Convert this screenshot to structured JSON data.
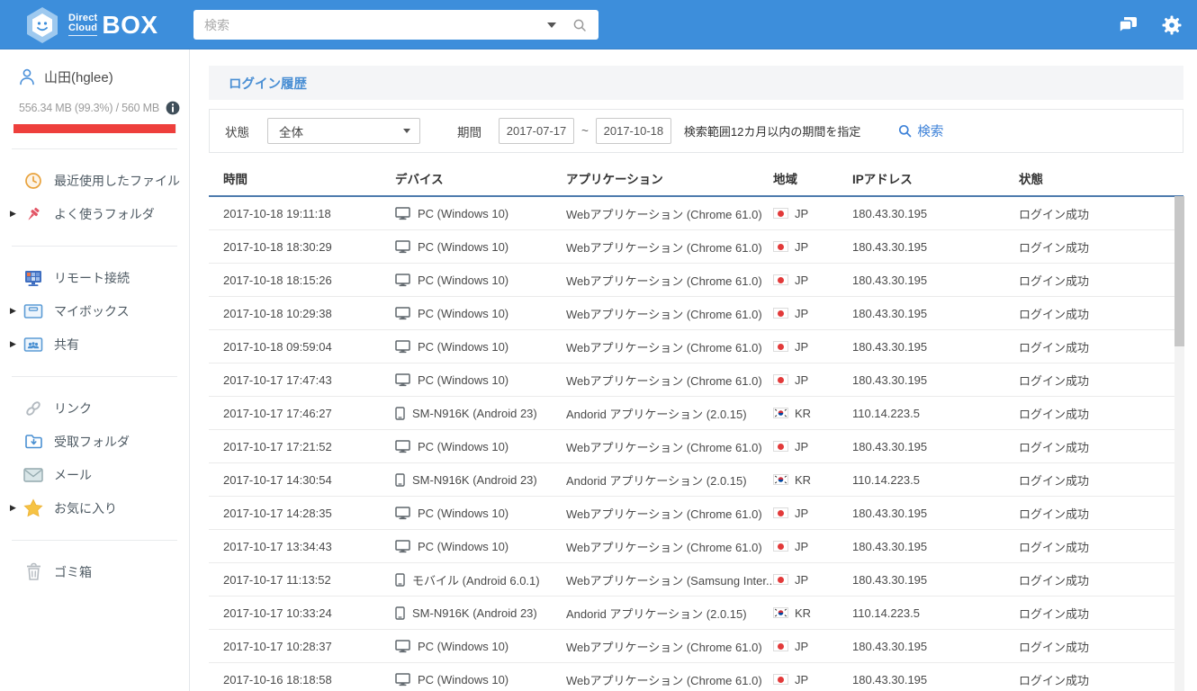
{
  "colors": {
    "header_bg": "#3d8edb",
    "title_text": "#4a8fd4",
    "storage_bar": "#ee3f3c",
    "link_blue": "#3e82d8",
    "table_header_border": "#4e7bad"
  },
  "header": {
    "logo": {
      "line1": "Direct",
      "line2": "Cloud",
      "box": "BOX"
    },
    "search": {
      "placeholder": "検索"
    }
  },
  "sidebar": {
    "user": {
      "name": "山田(hglee)"
    },
    "storage": {
      "usage_text": "556.34 MB (99.3%) / 560 MB",
      "percent": 99.3
    },
    "items": [
      {
        "label": "最近使用したファイル",
        "icon": "clock"
      },
      {
        "label": "よく使うフォルダ",
        "icon": "pin",
        "expandable": true
      },
      {
        "label": "リモート接続",
        "icon": "remote-desktop"
      },
      {
        "label": "マイボックス",
        "icon": "box",
        "expandable": true
      },
      {
        "label": "共有",
        "icon": "shared-box",
        "expandable": true
      },
      {
        "label": "リンク",
        "icon": "link"
      },
      {
        "label": "受取フォルダ",
        "icon": "receive-folder"
      },
      {
        "label": "メール",
        "icon": "mail"
      },
      {
        "label": "お気に入り",
        "icon": "star",
        "expandable": true
      },
      {
        "label": "ゴミ箱",
        "icon": "trash"
      }
    ]
  },
  "main": {
    "page_title": "ログイン履歴",
    "filters": {
      "status_label": "状態",
      "status_value": "全体",
      "period_label": "期間",
      "date_from": "2017-07-17",
      "date_separator": "~",
      "date_to": "2017-10-18",
      "hint": "検索範囲12カ月以内の期間を指定",
      "search_label": "検索"
    },
    "table": {
      "columns": [
        "時間",
        "デバイス",
        "アプリケーション",
        "地域",
        "IPアドレス",
        "状態"
      ],
      "rows": [
        {
          "time": "2017-10-18 19:11:18",
          "device": "PC (Windows 10)",
          "device_type": "pc",
          "app": "Webアプリケーション (Chrome 61.0)",
          "region": "JP",
          "ip": "180.43.30.195",
          "status": "ログイン成功"
        },
        {
          "time": "2017-10-18 18:30:29",
          "device": "PC (Windows 10)",
          "device_type": "pc",
          "app": "Webアプリケーション (Chrome 61.0)",
          "region": "JP",
          "ip": "180.43.30.195",
          "status": "ログイン成功"
        },
        {
          "time": "2017-10-18 18:15:26",
          "device": "PC (Windows 10)",
          "device_type": "pc",
          "app": "Webアプリケーション (Chrome 61.0)",
          "region": "JP",
          "ip": "180.43.30.195",
          "status": "ログイン成功"
        },
        {
          "time": "2017-10-18 10:29:38",
          "device": "PC (Windows 10)",
          "device_type": "pc",
          "app": "Webアプリケーション (Chrome 61.0)",
          "region": "JP",
          "ip": "180.43.30.195",
          "status": "ログイン成功"
        },
        {
          "time": "2017-10-18 09:59:04",
          "device": "PC (Windows 10)",
          "device_type": "pc",
          "app": "Webアプリケーション (Chrome 61.0)",
          "region": "JP",
          "ip": "180.43.30.195",
          "status": "ログイン成功"
        },
        {
          "time": "2017-10-17 17:47:43",
          "device": "PC (Windows 10)",
          "device_type": "pc",
          "app": "Webアプリケーション (Chrome 61.0)",
          "region": "JP",
          "ip": "180.43.30.195",
          "status": "ログイン成功"
        },
        {
          "time": "2017-10-17 17:46:27",
          "device": "SM-N916K (Android 23)",
          "device_type": "mobile",
          "app": "Andorid アプリケーション (2.0.15)",
          "region": "KR",
          "ip": "110.14.223.5",
          "status": "ログイン成功"
        },
        {
          "time": "2017-10-17 17:21:52",
          "device": "PC (Windows 10)",
          "device_type": "pc",
          "app": "Webアプリケーション (Chrome 61.0)",
          "region": "JP",
          "ip": "180.43.30.195",
          "status": "ログイン成功"
        },
        {
          "time": "2017-10-17 14:30:54",
          "device": "SM-N916K (Android 23)",
          "device_type": "mobile",
          "app": "Andorid アプリケーション (2.0.15)",
          "region": "KR",
          "ip": "110.14.223.5",
          "status": "ログイン成功"
        },
        {
          "time": "2017-10-17 14:28:35",
          "device": "PC (Windows 10)",
          "device_type": "pc",
          "app": "Webアプリケーション (Chrome 61.0)",
          "region": "JP",
          "ip": "180.43.30.195",
          "status": "ログイン成功"
        },
        {
          "time": "2017-10-17 13:34:43",
          "device": "PC (Windows 10)",
          "device_type": "pc",
          "app": "Webアプリケーション (Chrome 61.0)",
          "region": "JP",
          "ip": "180.43.30.195",
          "status": "ログイン成功"
        },
        {
          "time": "2017-10-17 11:13:52",
          "device": "モバイル (Android 6.0.1)",
          "device_type": "mobile",
          "app": "Webアプリケーション (Samsung Inter...",
          "region": "JP",
          "ip": "180.43.30.195",
          "status": "ログイン成功"
        },
        {
          "time": "2017-10-17 10:33:24",
          "device": "SM-N916K (Android 23)",
          "device_type": "mobile",
          "app": "Andorid アプリケーション (2.0.15)",
          "region": "KR",
          "ip": "110.14.223.5",
          "status": "ログイン成功"
        },
        {
          "time": "2017-10-17 10:28:37",
          "device": "PC (Windows 10)",
          "device_type": "pc",
          "app": "Webアプリケーション (Chrome 61.0)",
          "region": "JP",
          "ip": "180.43.30.195",
          "status": "ログイン成功"
        },
        {
          "time": "2017-10-16 18:18:58",
          "device": "PC (Windows 10)",
          "device_type": "pc",
          "app": "Webアプリケーション (Chrome 61.0)",
          "region": "JP",
          "ip": "180.43.30.195",
          "status": "ログイン成功"
        }
      ]
    }
  }
}
